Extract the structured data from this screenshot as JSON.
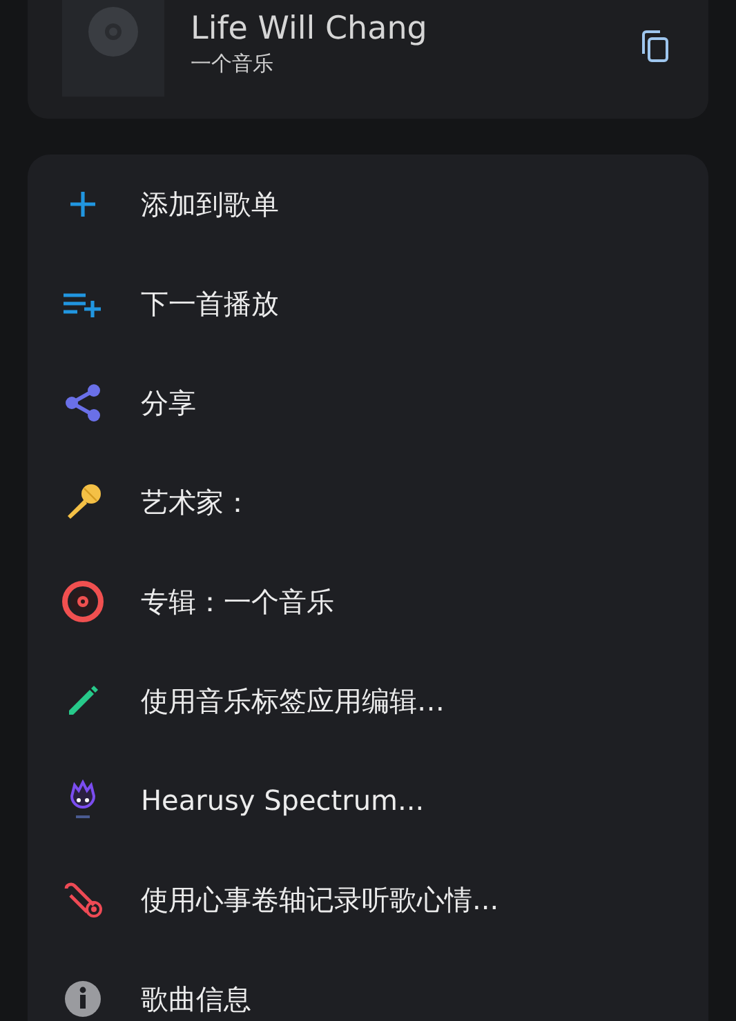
{
  "song": {
    "title": "Life Will Chang",
    "artist": "一个音乐"
  },
  "menu": [
    {
      "label": "添加到歌单"
    },
    {
      "label": "下一首播放"
    },
    {
      "label": "分享"
    },
    {
      "label": "艺术家："
    },
    {
      "label": "专辑：一个音乐"
    },
    {
      "label": "使用音乐标签应用编辑…"
    },
    {
      "label": "Hearusy Spectrum..."
    },
    {
      "label": "使用心事卷轴记录听歌心情..."
    },
    {
      "label": "歌曲信息"
    }
  ]
}
